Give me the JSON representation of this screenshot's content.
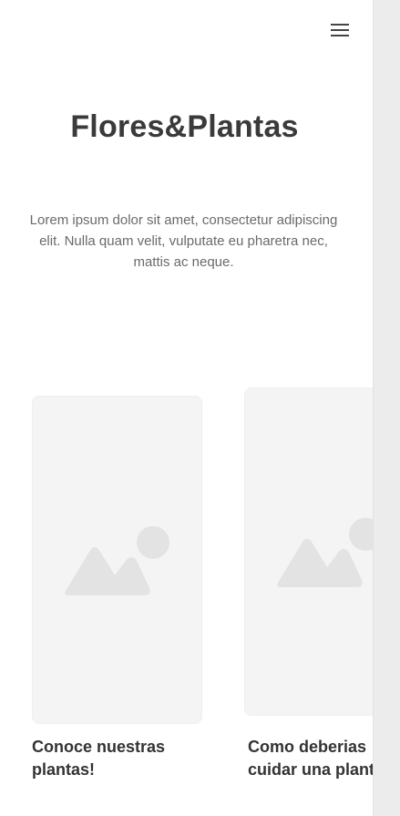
{
  "header": {
    "menu_icon": "hamburger-menu-icon"
  },
  "hero": {
    "title": "Flores&Plantas",
    "description": "Lorem ipsum dolor sit amet, consectetur adipiscing elit. Nulla quam velit, vulputate eu pharetra nec, mattis ac neque."
  },
  "cards": [
    {
      "caption_line1": "Conoce nuestras",
      "caption_line2": "plantas!",
      "image_icon": "image-placeholder-icon"
    },
    {
      "caption_line1": "Como deberias",
      "caption_line2": "cuidar una planta",
      "image_icon": "image-placeholder-icon"
    }
  ],
  "colors": {
    "placeholder_bg": "#f4f4f4",
    "placeholder_icon": "#e3e3e3",
    "scrollbar": "#ececec",
    "text": "#333333"
  }
}
